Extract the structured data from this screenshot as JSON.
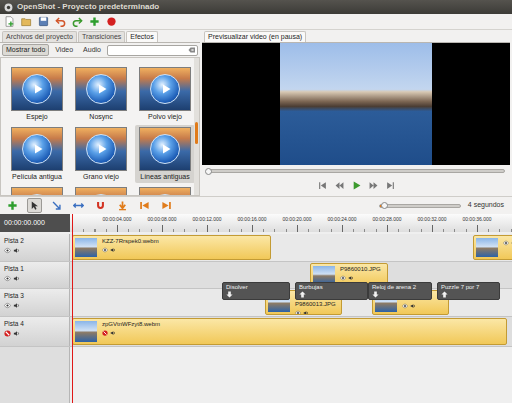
{
  "window": {
    "title": "OpenShot - Proyecto predeterminado"
  },
  "panel_tabs": [
    {
      "label": "Archivos del proyecto",
      "selected": false
    },
    {
      "label": "Transiciones",
      "selected": false
    },
    {
      "label": "Efectos",
      "selected": true
    }
  ],
  "filters": [
    {
      "label": "Mostrar todo",
      "selected": true
    },
    {
      "label": "Video",
      "selected": false
    },
    {
      "label": "Audio",
      "selected": false
    }
  ],
  "effects": [
    {
      "label": "Espejo",
      "selected": false
    },
    {
      "label": "Nosync",
      "selected": false
    },
    {
      "label": "Polvo viejo",
      "selected": false
    },
    {
      "label": "Película antigua",
      "selected": false
    },
    {
      "label": "Grano viejo",
      "selected": false
    },
    {
      "label": "Líneas antiguas",
      "selected": true
    }
  ],
  "preview": {
    "tab": "Previsualizar video (en pausa)",
    "level": 0
  },
  "timeline": {
    "tools": [
      {
        "selected": false
      },
      {
        "selected": true
      },
      {
        "selected": false
      },
      {
        "selected": false
      },
      {
        "selected": false
      },
      {
        "selected": false
      },
      {
        "selected": false
      },
      {
        "selected": false
      }
    ],
    "zoom_label": "4 segundos",
    "zoom_level": 0.05,
    "current_time": "00:00:00.000",
    "ruler": [
      "00:00:04.000",
      "00:00:08.000",
      "00:00:12.000",
      "00:00:16.000",
      "00:00:20.000",
      "00:00:24.000",
      "00:00:28.000",
      "00:00:32.000",
      "00:00:36.000"
    ]
  },
  "tracks": [
    {
      "name": "Pista 2",
      "visible": true,
      "clips": [
        {
          "name": "KZZ-7Rrspek0.webm"
        },
        {}
      ]
    },
    {
      "name": "Pista 1",
      "visible": true,
      "clips": [
        {
          "name": "P9860010.JPG"
        }
      ]
    },
    {
      "name": "Pista 3",
      "visible": true,
      "clips": [
        {
          "name": "P9860013.JPG"
        },
        {}
      ]
    },
    {
      "name": "Pista 4",
      "visible": false,
      "clips": [
        {
          "name": "zpGVtnWFzyt8.webm"
        }
      ]
    }
  ],
  "transitions": [
    {
      "label": "Disolver",
      "direction": "down"
    },
    {
      "label": "Burbujas",
      "direction": "up"
    },
    {
      "label": "Reloj de arena 2",
      "direction": "down"
    },
    {
      "label": "Puzzle 7 por 7",
      "direction": "up"
    }
  ]
}
